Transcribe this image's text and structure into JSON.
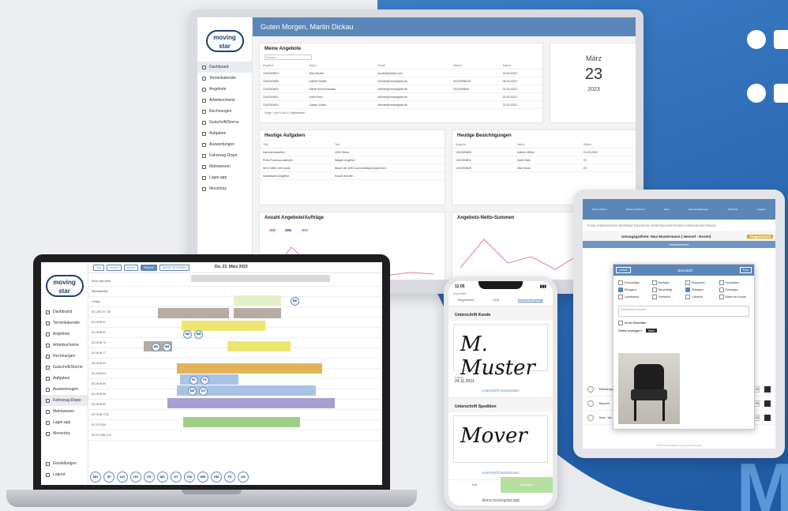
{
  "monitor": {
    "logo": "moving star",
    "greeting": "Guten Morgen, Martin Dickau",
    "nav": [
      "Dashboard",
      "Terminkalender",
      "Angebote",
      "Arbeitsscheine",
      "Rechnungen",
      "Gutschrift/Storno",
      "Aufgaben",
      "Auswertungen",
      "Fahrzeug-Dispo",
      "Mahnwesen",
      "Lager.app",
      "Moverbiry"
    ],
    "offers": {
      "title": "Meine Angebote",
      "search_placeholder": "Suchen...",
      "headers": [
        "Angebot",
        "Name",
        "Email",
        "Telefon",
        "Datum"
      ],
      "rows": [
        [
          "1202303811",
          "Max Muster",
          "kunde@ahhtar.com",
          "",
          "23.03.2023"
        ],
        [
          "1202303805",
          "Kathrin Müller",
          "verhels@movingstar.de",
          "02242998120",
          "08.03.2023"
        ],
        [
          "1202303802",
          "Martin Mönchhausen",
          "verhels@movingstar.de",
          "0224299899",
          "02.03.2023"
        ],
        [
          "1202303811",
          "Karin Klein",
          "verhels@movingstar.de",
          "",
          "23.02.2023"
        ],
        [
          "1202303810",
          "Justus Jonas",
          "verhels@movingstar.de",
          "",
          "23.02.2023"
        ]
      ],
      "footer": "Zeige 1 bis 6 von 6 Ergebnissen",
      "pager": [
        "Zurück",
        "1",
        "2",
        "Weiter"
      ]
    },
    "calendar": {
      "month": "März",
      "day": "23",
      "year": "2023"
    },
    "tasks": {
      "title": "Heutige Aufgaben",
      "headers": [
        "Titel",
        "Text"
      ],
      "rows": [
        [
          "Kartons besteilen",
          "2000 Stück"
        ],
        [
          "Preis Puma zurückrufen",
          "Wegen Angebot"
        ],
        [
          "MHZ bitten mit Kunde",
          "Bauer der MHZ und Umfang besprechen"
        ],
        [
          "Nachfassen Angebot",
          "Kunde anrufen"
        ]
      ]
    },
    "inspections": {
      "title": "Heutige Besichtigungen",
      "headers": [
        "Angebot",
        "Name",
        "Datum"
      ],
      "rows": [
        [
          "1202303805",
          "Kathrin Müller",
          "23.03.2023"
        ],
        [
          "1202303811",
          "Karin Klein",
          "23"
        ],
        [
          "1202303820",
          "Max Kruse",
          "23"
        ]
      ]
    },
    "chart1_title": "Anzahl Angebote/Aufträge",
    "chart2_title": "Angebots-Netto-Summen"
  },
  "laptop": {
    "logo": "moving star",
    "nav": [
      "Dashboard",
      "Terminkalender",
      "Angebote",
      "Arbeitsscheine",
      "Rechnungen",
      "Gutschrift/Storno",
      "Aufgaben",
      "Auswertungen",
      "Fahrzeug-Dispo",
      "Mahnwesen",
      "Lager.app",
      "Moverbiry"
    ],
    "bottom_nav": [
      "Einstellungen",
      "Logout"
    ],
    "toolbar": [
      "Tag",
      "Woche",
      "Monat",
      "Disposit",
      "MEHR OPTIONEN"
    ],
    "date": "Do, 23. März 2023",
    "rows": [
      "Nicht zugeordnet",
      "Mitarbeiterliste",
      "Vorlage",
      "DO-LMO GT 726",
      "DO-HOM 61",
      "DO-HOM 63",
      "DO-HOM 76",
      "DO-HOM 77",
      "DO-HOM 80",
      "DO-HOM 84",
      "DO-HOM 89",
      "DO-HOM 88",
      "DO-HOM 82",
      "DO-HOM 72CE",
      "DO-FS 5100",
      "DO-FS 2305 LCE"
    ],
    "avatars": [
      "MD",
      "SF",
      "KH",
      "HH",
      "FK",
      "MK",
      "XY",
      "FM",
      "MM",
      "HM",
      "FS",
      "US"
    ]
  },
  "tablet": {
    "toolbar": [
      "Neues Datum",
      "Zimmer entfernen",
      "Infos",
      "Raumeinstellungen",
      "Übersicht",
      "Angebot"
    ],
    "tabs": "Fotos   Arbeitszimmer   Diele/Bad   Esszimmer   Keller/Speicher/Garten   Kinderzimmer/Studio",
    "title": "Umzugsgutliste: Max Mustermann ( Hennef - Essen)",
    "gegenstand": "Gegenstand",
    "subtitle": "Arbeitszimmer",
    "modal": {
      "back": "zurück",
      "title": "Bürostuhl",
      "photo": "Foto",
      "options": [
        "Demontage",
        "Montage",
        "Einpacken",
        "Auspacken",
        "Einlagern",
        "Beschädigt",
        "Einlagern",
        "Entsorgen",
        "Landtransp.",
        "Seetracht",
        "Luftracht",
        "Bleibt bei Kunde"
      ],
      "info_placeholder": "Zusatzinformationen",
      "packmittel": "Ist ein Packmittel",
      "zeiten": "Zeiten anzeigen?",
      "nein": "Nein"
    },
    "items": [
      {
        "name": "Stehlampe",
        "qty": "0",
        "price": "2.00"
      },
      {
        "name": "Teppich",
        "qty": "0",
        "price": "3.00"
      },
      {
        "name": "Tisch, bis 0,6 m",
        "qty": "0",
        "price": "4.00"
      }
    ],
    "footer": "© 2019 movestarPRO movingstar.de GmbH"
  },
  "phone": {
    "time": "11:05",
    "back": "Kopfzeilen",
    "tabs": [
      "Wegestrecke",
      "Infos",
      "Dokumentenpflege"
    ],
    "sig_customer_title": "Unterschrift Kunde",
    "sig_customer": "M. Muster",
    "date_label": "Datum",
    "date_value": "24.11.2021",
    "reset1": "Unterschrift zurücksetzen",
    "sig_mover_title": "Unterschrift Spedition",
    "sig_mover": "Mover",
    "reset2": "Unterschrift zurücksetzen",
    "bottom": [
      "Mail",
      "Speichern"
    ],
    "url": "demo.movingstar.app"
  }
}
